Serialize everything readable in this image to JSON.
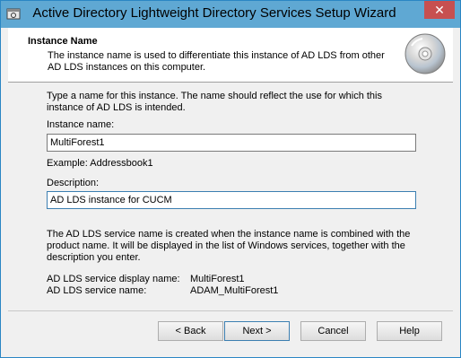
{
  "window": {
    "title": "Active Directory Lightweight Directory Services Setup Wizard"
  },
  "header": {
    "title": "Instance Name",
    "description": "The instance name is used to differentiate this instance of AD LDS from other AD LDS instances on this computer."
  },
  "form": {
    "intro": "Type a name for this instance. The name should reflect the use for which this instance of AD LDS is intended.",
    "instance_name_label": "Instance name:",
    "instance_name_value": "MultiForest1",
    "example": "Example: Addressbook1",
    "description_label": "Description:",
    "description_value": "AD LDS instance for CUCM"
  },
  "info": {
    "text": "The AD LDS service name is created when the instance name is combined with the product name. It will be displayed in the list of Windows services, together with the description you enter.",
    "display_name_label": "AD LDS service display name:",
    "display_name_value": "MultiForest1",
    "service_name_label": "AD LDS service name:",
    "service_name_value": "ADAM_MultiForest1"
  },
  "buttons": {
    "back": "< Back",
    "next": "Next >",
    "cancel": "Cancel",
    "help": "Help"
  },
  "icons": {
    "app": "setup-wizard-icon",
    "header": "cd-disc-icon",
    "close": "close-icon"
  },
  "colors": {
    "titlebar": "#5fa8d3",
    "close": "#c75050",
    "focus_border": "#3c7fb1"
  }
}
